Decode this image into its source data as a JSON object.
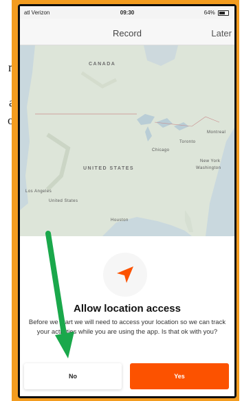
{
  "side_text": [
    "m",
    "n",
    "al",
    "or"
  ],
  "status_bar": {
    "carrier": "atl Verizon",
    "time": "09:30",
    "battery": "64%"
  },
  "nav": {
    "title": "Record",
    "later_label": "Later"
  },
  "map": {
    "labels": {
      "canada": "CANADA",
      "united_states": "UNITED STATES",
      "montreal": "Montreal",
      "toronto": "Toronto",
      "chicago": "Chicago",
      "new_york": "New York",
      "washington": "Washington",
      "los_angeles": "Los Angeles",
      "united_states_small": "United States",
      "houston": "Houston"
    }
  },
  "sheet": {
    "icon": "location-arrow-icon",
    "title": "Allow location access",
    "body": "Before we start we will need to access your location so we can track your activities while you are using the app. Is that ok with you?",
    "no_label": "No",
    "yes_label": "Yes"
  },
  "colors": {
    "frame": "#f39c1f",
    "accent": "#fc5200",
    "annotation_arrow": "#1aa84b"
  }
}
